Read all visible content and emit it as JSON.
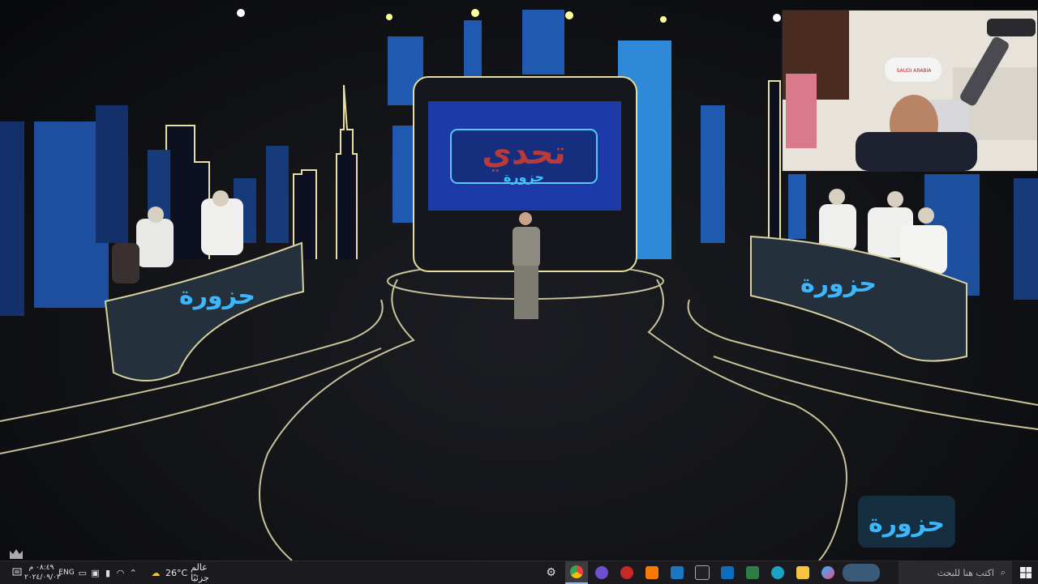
{
  "video": {
    "screen_title": "تحدي",
    "screen_subtitle": "حزورة",
    "desk_logo_left": "حزورة",
    "desk_logo_right": "حزورة",
    "corner_logo": "حزورة",
    "webcam_cap_text": "SAUDI ARABIA"
  },
  "taskbar": {
    "search_placeholder": "اكتب هنا للبحث",
    "weather_temp": "26°C",
    "weather_label": "عالم جزئيًا",
    "language": "ENG",
    "clock_time": "٠٨:٤٩ م",
    "clock_date": "٢٠٢٤/٠٩/٠٣",
    "apps": [
      "settings-icon",
      "chrome-icon",
      "obs-icon",
      "game-icon",
      "vlc-icon",
      "window-icon",
      "capcut-icon",
      "mail-icon",
      "store-icon",
      "edge-icon",
      "explorer-icon",
      "copilot-icon",
      "thumbnail"
    ],
    "accent": "#8ab4f8"
  }
}
